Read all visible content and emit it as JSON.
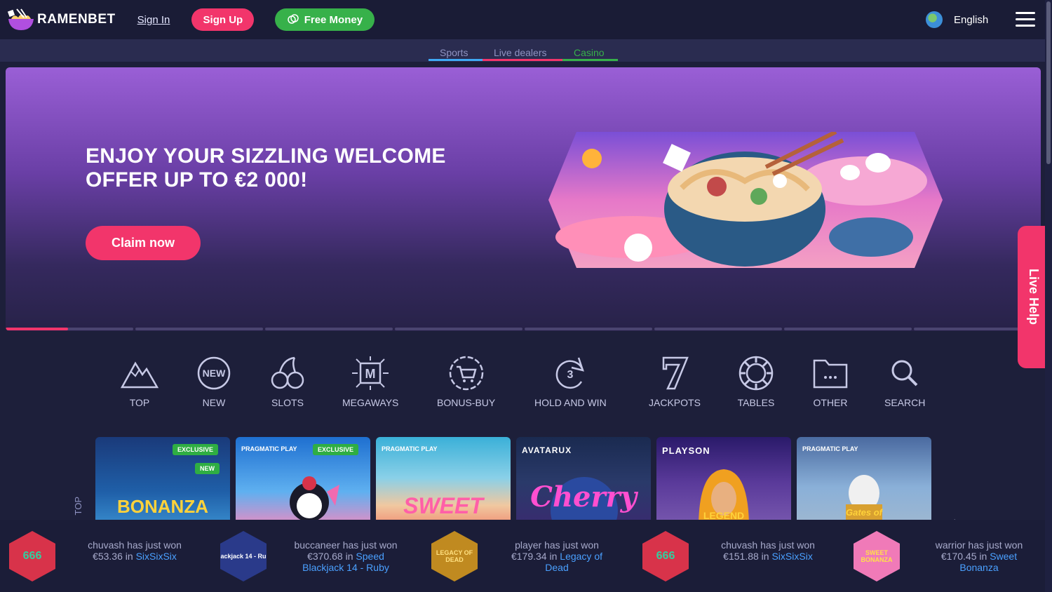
{
  "header": {
    "brand": "RAMENBET",
    "signin": "Sign In",
    "signup": "Sign Up",
    "freemoney": "Free Money",
    "language": "English"
  },
  "subnav": {
    "tabs": [
      {
        "label": "Sports",
        "color": "#3fa9f5"
      },
      {
        "label": "Live dealers",
        "color": "#f2356b"
      },
      {
        "label": "Casino",
        "color": "#37b14a"
      }
    ]
  },
  "banner": {
    "title": "ENJOY YOUR SIZZLING WELCOME OFFER UP TO €2 000!",
    "cta": "Claim now"
  },
  "livehelp": "Live Help",
  "categories": [
    {
      "label": "TOP",
      "icon": "mountain-icon"
    },
    {
      "label": "NEW",
      "icon": "new-badge-icon"
    },
    {
      "label": "SLOTS",
      "icon": "cherries-icon"
    },
    {
      "label": "MEGAWAYS",
      "icon": "megaways-icon"
    },
    {
      "label": "BONUS-BUY",
      "icon": "cart-icon"
    },
    {
      "label": "HOLD AND WIN",
      "icon": "three-cycle-icon"
    },
    {
      "label": "JACKPOTS",
      "icon": "seven-icon"
    },
    {
      "label": "TABLES",
      "icon": "chip-icon"
    },
    {
      "label": "OTHER",
      "icon": "folder-icon"
    },
    {
      "label": "SEARCH",
      "icon": "search-icon"
    }
  ],
  "games_section_label": "TOP",
  "games": [
    {
      "provider": "",
      "badges": [
        "EXCLUSIVE",
        "NEW"
      ],
      "title": "BONANZA"
    },
    {
      "provider": "PRAGMATIC PLAY",
      "badges": [
        "EXCLUSIVE"
      ],
      "title": ""
    },
    {
      "provider": "PRAGMATIC PLAY",
      "badges": [],
      "title": "SWEET"
    },
    {
      "provider": "AVATARUX",
      "badges": [],
      "title": "Cherry"
    },
    {
      "provider": "PLAYSON",
      "badges": [],
      "title": "LEGEND"
    },
    {
      "provider": "PRAGMATIC PLAY",
      "badges": [],
      "title": "Gates of"
    }
  ],
  "winners": [
    {
      "user_line": "chuvash has just won",
      "amount_line": "€53.36 in",
      "game": "SixSixSix",
      "game2": "",
      "icon_text": "666"
    },
    {
      "user_line": "buccaneer has just won",
      "amount_line": "€370.68 in",
      "game": "Speed",
      "game2": "Blackjack 14 - Ruby",
      "icon_text": "ackjack 14 - Ru"
    },
    {
      "user_line": "player has just won",
      "amount_line": "€179.34 in",
      "game": "Legacy of",
      "game2": "Dead",
      "icon_text": "LEGACY OF DEAD"
    },
    {
      "user_line": "chuvash has just won",
      "amount_line": "€151.88 in",
      "game": "SixSixSix",
      "game2": "",
      "icon_text": "666"
    },
    {
      "user_line": "warrior has just won",
      "amount_line": "€170.45 in",
      "game": "Sweet",
      "game2": "Bonanza",
      "icon_text": "SWEET BONANZA"
    }
  ]
}
